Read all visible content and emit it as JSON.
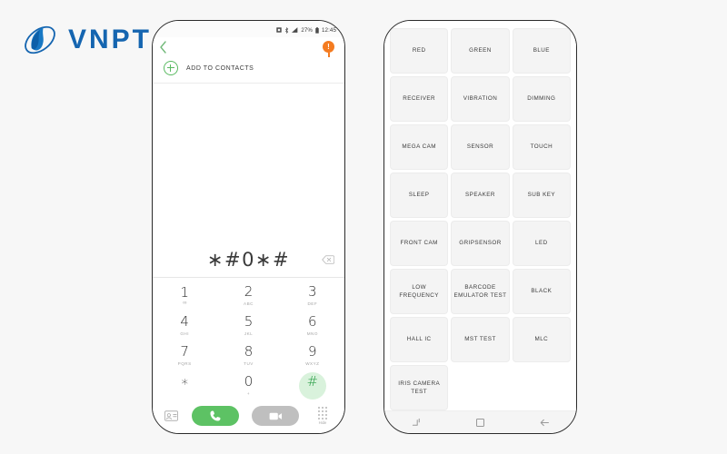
{
  "brand": {
    "name": "VNPT",
    "logo_icon": "vnpt-globe-icon",
    "color": "#1565b0"
  },
  "background_color": "#f7f7f7",
  "phone_dialer": {
    "status_bar": {
      "icons": [
        "sim-card-icon",
        "bluetooth-icon",
        "signal-bars-icon",
        "battery-icon"
      ],
      "battery_percent": "27%",
      "time": "12:45"
    },
    "top_bar": {
      "back_icon": "back-chevron-icon",
      "badge_icon": "orange-notification-badge-icon",
      "badge_label": "!"
    },
    "add_to_contacts": {
      "icon": "plus-circle-icon",
      "label": "ADD TO CONTACTS"
    },
    "dial_display": {
      "number": "∗#0∗#",
      "backspace_icon": "backspace-icon"
    },
    "keypad": [
      {
        "digit": "1",
        "sub": "∞",
        "sub_kind": "voicemail",
        "highlight": false
      },
      {
        "digit": "2",
        "sub": "ABC",
        "sub_kind": "letters",
        "highlight": false
      },
      {
        "digit": "3",
        "sub": "DEF",
        "sub_kind": "letters",
        "highlight": false
      },
      {
        "digit": "4",
        "sub": "GHI",
        "sub_kind": "letters",
        "highlight": false
      },
      {
        "digit": "5",
        "sub": "JKL",
        "sub_kind": "letters",
        "highlight": false
      },
      {
        "digit": "6",
        "sub": "MNO",
        "sub_kind": "letters",
        "highlight": false
      },
      {
        "digit": "7",
        "sub": "PQRS",
        "sub_kind": "letters",
        "highlight": false
      },
      {
        "digit": "8",
        "sub": "TUV",
        "sub_kind": "letters",
        "highlight": false
      },
      {
        "digit": "9",
        "sub": "WXYZ",
        "sub_kind": "letters",
        "highlight": false
      },
      {
        "digit": "∗",
        "sub": "",
        "sub_kind": "none",
        "highlight": false
      },
      {
        "digit": "0",
        "sub": "+",
        "sub_kind": "letters",
        "highlight": false
      },
      {
        "digit": "#",
        "sub": "",
        "sub_kind": "none",
        "highlight": true
      }
    ],
    "call_bar": {
      "contacts_icon": "add-contact-card-icon",
      "call_icon": "phone-handset-icon",
      "video_icon": "video-camera-icon",
      "hide_icon": "keypad-dots-icon",
      "hide_label": "Hide",
      "call_color": "#5dc264",
      "video_color": "#bfbfbf"
    }
  },
  "phone_testmenu": {
    "grid_items": [
      "RED",
      "GREEN",
      "BLUE",
      "RECEIVER",
      "VIBRATION",
      "DIMMING",
      "MEGA CAM",
      "SENSOR",
      "TOUCH",
      "SLEEP",
      "SPEAKER",
      "SUB KEY",
      "FRONT CAM",
      "GRIPSENSOR",
      "LED",
      "LOW FREQUENCY",
      "BARCODE\nEMULATOR TEST",
      "BLACK",
      "HALL IC",
      "MST TEST",
      "MLC",
      "IRIS CAMERA TEST",
      "",
      ""
    ],
    "nav_bar": {
      "recents_icon": "recents-icon",
      "home_icon": "home-square-icon",
      "back_icon": "back-arrow-icon"
    }
  }
}
